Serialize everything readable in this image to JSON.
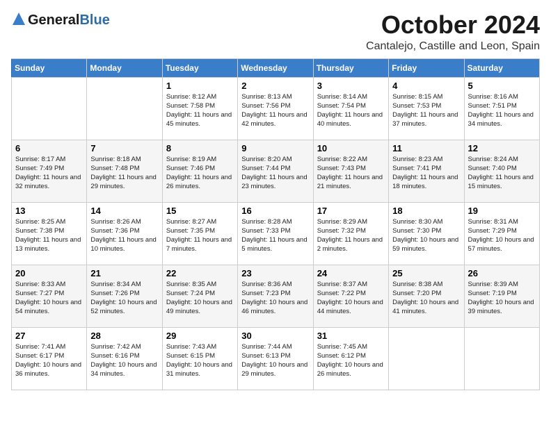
{
  "header": {
    "logo_general": "General",
    "logo_blue": "Blue",
    "month": "October 2024",
    "location": "Cantalejo, Castille and Leon, Spain"
  },
  "days_of_week": [
    "Sunday",
    "Monday",
    "Tuesday",
    "Wednesday",
    "Thursday",
    "Friday",
    "Saturday"
  ],
  "weeks": [
    [
      {
        "day": "",
        "info": ""
      },
      {
        "day": "",
        "info": ""
      },
      {
        "day": "1",
        "info": "Sunrise: 8:12 AM\nSunset: 7:58 PM\nDaylight: 11 hours and 45 minutes."
      },
      {
        "day": "2",
        "info": "Sunrise: 8:13 AM\nSunset: 7:56 PM\nDaylight: 11 hours and 42 minutes."
      },
      {
        "day": "3",
        "info": "Sunrise: 8:14 AM\nSunset: 7:54 PM\nDaylight: 11 hours and 40 minutes."
      },
      {
        "day": "4",
        "info": "Sunrise: 8:15 AM\nSunset: 7:53 PM\nDaylight: 11 hours and 37 minutes."
      },
      {
        "day": "5",
        "info": "Sunrise: 8:16 AM\nSunset: 7:51 PM\nDaylight: 11 hours and 34 minutes."
      }
    ],
    [
      {
        "day": "6",
        "info": "Sunrise: 8:17 AM\nSunset: 7:49 PM\nDaylight: 11 hours and 32 minutes."
      },
      {
        "day": "7",
        "info": "Sunrise: 8:18 AM\nSunset: 7:48 PM\nDaylight: 11 hours and 29 minutes."
      },
      {
        "day": "8",
        "info": "Sunrise: 8:19 AM\nSunset: 7:46 PM\nDaylight: 11 hours and 26 minutes."
      },
      {
        "day": "9",
        "info": "Sunrise: 8:20 AM\nSunset: 7:44 PM\nDaylight: 11 hours and 23 minutes."
      },
      {
        "day": "10",
        "info": "Sunrise: 8:22 AM\nSunset: 7:43 PM\nDaylight: 11 hours and 21 minutes."
      },
      {
        "day": "11",
        "info": "Sunrise: 8:23 AM\nSunset: 7:41 PM\nDaylight: 11 hours and 18 minutes."
      },
      {
        "day": "12",
        "info": "Sunrise: 8:24 AM\nSunset: 7:40 PM\nDaylight: 11 hours and 15 minutes."
      }
    ],
    [
      {
        "day": "13",
        "info": "Sunrise: 8:25 AM\nSunset: 7:38 PM\nDaylight: 11 hours and 13 minutes."
      },
      {
        "day": "14",
        "info": "Sunrise: 8:26 AM\nSunset: 7:36 PM\nDaylight: 11 hours and 10 minutes."
      },
      {
        "day": "15",
        "info": "Sunrise: 8:27 AM\nSunset: 7:35 PM\nDaylight: 11 hours and 7 minutes."
      },
      {
        "day": "16",
        "info": "Sunrise: 8:28 AM\nSunset: 7:33 PM\nDaylight: 11 hours and 5 minutes."
      },
      {
        "day": "17",
        "info": "Sunrise: 8:29 AM\nSunset: 7:32 PM\nDaylight: 11 hours and 2 minutes."
      },
      {
        "day": "18",
        "info": "Sunrise: 8:30 AM\nSunset: 7:30 PM\nDaylight: 10 hours and 59 minutes."
      },
      {
        "day": "19",
        "info": "Sunrise: 8:31 AM\nSunset: 7:29 PM\nDaylight: 10 hours and 57 minutes."
      }
    ],
    [
      {
        "day": "20",
        "info": "Sunrise: 8:33 AM\nSunset: 7:27 PM\nDaylight: 10 hours and 54 minutes."
      },
      {
        "day": "21",
        "info": "Sunrise: 8:34 AM\nSunset: 7:26 PM\nDaylight: 10 hours and 52 minutes."
      },
      {
        "day": "22",
        "info": "Sunrise: 8:35 AM\nSunset: 7:24 PM\nDaylight: 10 hours and 49 minutes."
      },
      {
        "day": "23",
        "info": "Sunrise: 8:36 AM\nSunset: 7:23 PM\nDaylight: 10 hours and 46 minutes."
      },
      {
        "day": "24",
        "info": "Sunrise: 8:37 AM\nSunset: 7:22 PM\nDaylight: 10 hours and 44 minutes."
      },
      {
        "day": "25",
        "info": "Sunrise: 8:38 AM\nSunset: 7:20 PM\nDaylight: 10 hours and 41 minutes."
      },
      {
        "day": "26",
        "info": "Sunrise: 8:39 AM\nSunset: 7:19 PM\nDaylight: 10 hours and 39 minutes."
      }
    ],
    [
      {
        "day": "27",
        "info": "Sunrise: 7:41 AM\nSunset: 6:17 PM\nDaylight: 10 hours and 36 minutes."
      },
      {
        "day": "28",
        "info": "Sunrise: 7:42 AM\nSunset: 6:16 PM\nDaylight: 10 hours and 34 minutes."
      },
      {
        "day": "29",
        "info": "Sunrise: 7:43 AM\nSunset: 6:15 PM\nDaylight: 10 hours and 31 minutes."
      },
      {
        "day": "30",
        "info": "Sunrise: 7:44 AM\nSunset: 6:13 PM\nDaylight: 10 hours and 29 minutes."
      },
      {
        "day": "31",
        "info": "Sunrise: 7:45 AM\nSunset: 6:12 PM\nDaylight: 10 hours and 26 minutes."
      },
      {
        "day": "",
        "info": ""
      },
      {
        "day": "",
        "info": ""
      }
    ]
  ]
}
